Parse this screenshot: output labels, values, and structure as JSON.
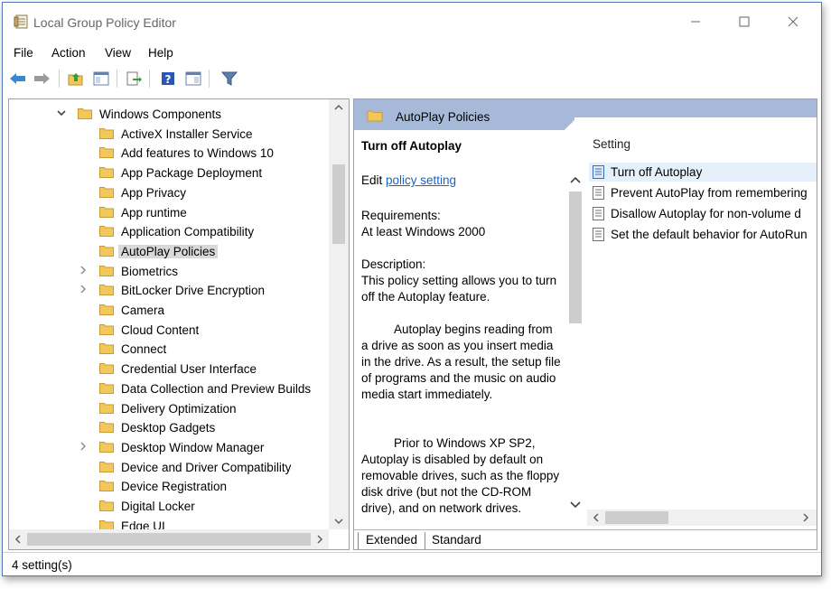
{
  "window": {
    "title": "Local Group Policy Editor"
  },
  "menu": [
    "File",
    "Action",
    "View",
    "Help"
  ],
  "tree": [
    {
      "label": "Windows Components",
      "expander": "expanded",
      "level": 0
    },
    {
      "label": "ActiveX Installer Service",
      "expander": "none",
      "level": 1
    },
    {
      "label": "Add features to Windows 10",
      "expander": "none",
      "level": 1
    },
    {
      "label": "App Package Deployment",
      "expander": "none",
      "level": 1
    },
    {
      "label": "App Privacy",
      "expander": "none",
      "level": 1
    },
    {
      "label": "App runtime",
      "expander": "none",
      "level": 1
    },
    {
      "label": "Application Compatibility",
      "expander": "none",
      "level": 1
    },
    {
      "label": "AutoPlay Policies",
      "expander": "none",
      "level": 1,
      "selected": true
    },
    {
      "label": "Biometrics",
      "expander": "collapsed",
      "level": 1
    },
    {
      "label": "BitLocker Drive Encryption",
      "expander": "collapsed",
      "level": 1
    },
    {
      "label": "Camera",
      "expander": "none",
      "level": 1
    },
    {
      "label": "Cloud Content",
      "expander": "none",
      "level": 1
    },
    {
      "label": "Connect",
      "expander": "none",
      "level": 1
    },
    {
      "label": "Credential User Interface",
      "expander": "none",
      "level": 1
    },
    {
      "label": "Data Collection and Preview Builds",
      "expander": "none",
      "level": 1
    },
    {
      "label": "Delivery Optimization",
      "expander": "none",
      "level": 1
    },
    {
      "label": "Desktop Gadgets",
      "expander": "none",
      "level": 1
    },
    {
      "label": "Desktop Window Manager",
      "expander": "collapsed",
      "level": 1
    },
    {
      "label": "Device and Driver Compatibility",
      "expander": "none",
      "level": 1
    },
    {
      "label": "Device Registration",
      "expander": "none",
      "level": 1
    },
    {
      "label": "Digital Locker",
      "expander": "none",
      "level": 1
    },
    {
      "label": "Edge UI",
      "expander": "none",
      "level": 1
    }
  ],
  "details": {
    "header": "AutoPlay Policies",
    "title": "Turn off Autoplay",
    "edit_prefix": "Edit ",
    "edit_link": "policy setting ",
    "requirements_label": "Requirements:",
    "requirements_value": "At least Windows 2000",
    "description_label": "Description:",
    "description_1": "This policy setting allows you to turn off the Autoplay feature.",
    "description_2": "Autoplay begins reading from a drive as soon as you insert media in the drive. As a result, the setup file of programs and the music on audio media start immediately.",
    "description_3": "Prior to Windows XP SP2, Autoplay is disabled by default on removable drives, such as the floppy disk drive (but not the CD-ROM drive), and on network drives."
  },
  "settings": {
    "column_header": "Setting",
    "items": [
      "Turn off Autoplay",
      "Prevent AutoPlay from remembering",
      "Disallow Autoplay for non-volume d",
      "Set the default behavior for AutoRun"
    ]
  },
  "tabs": {
    "extended": "Extended",
    "standard": "Standard"
  },
  "status": "4 setting(s)",
  "colors": {
    "header_band": "#a6b9d8",
    "link": "#1b62c6",
    "selection": "#d9d9d9",
    "folder": "#f2c85b"
  }
}
